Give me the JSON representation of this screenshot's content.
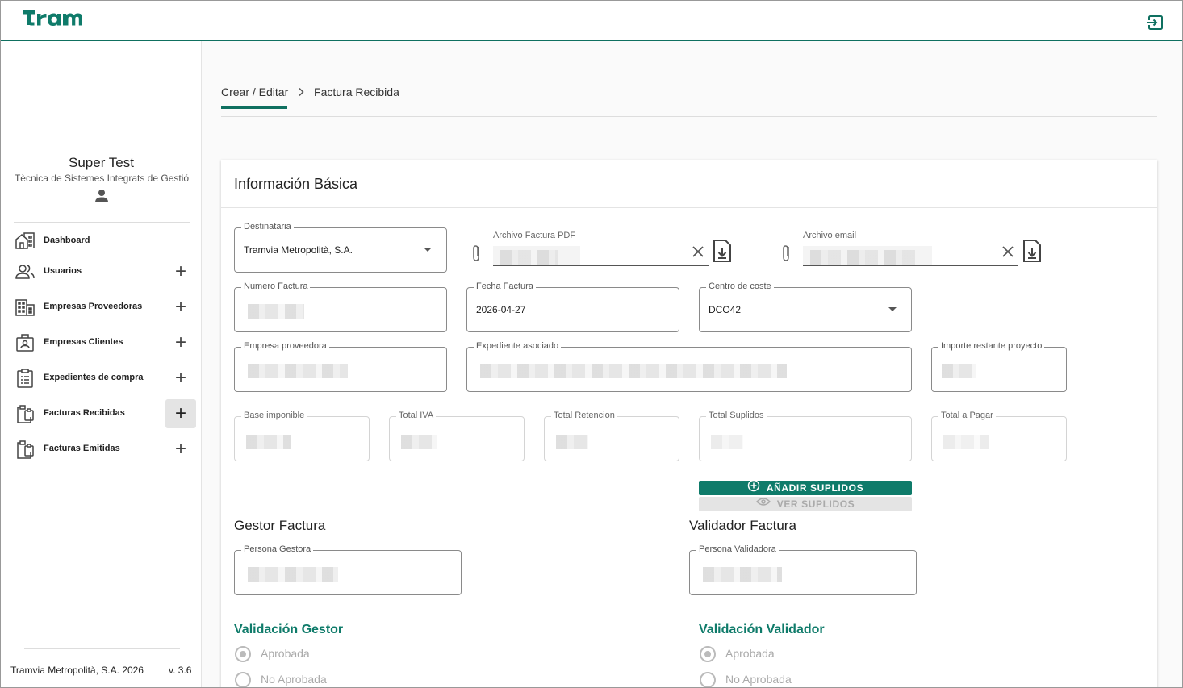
{
  "header": {
    "logo": "TRAM",
    "logout_icon": "logout-icon"
  },
  "user": {
    "name": "Super Test",
    "org": "Tècnica de Sistemes Integrats de Gestió",
    "icon": "person-icon"
  },
  "sidebar": {
    "items": [
      {
        "label": "Dashboard",
        "icon": "dashboard-icon"
      },
      {
        "label": "Usuarios",
        "icon": "users-icon"
      },
      {
        "label": "Empresas Proveedoras",
        "icon": "building-icon"
      },
      {
        "label": "Empresas Clientes",
        "icon": "badge-icon"
      },
      {
        "label": "Expedientes de compra",
        "icon": "clipboard-list-icon"
      },
      {
        "label": "Facturas Recibidas",
        "icon": "clipboard-icon"
      },
      {
        "label": "Facturas Emitidas",
        "icon": "clipboard-icon"
      }
    ],
    "plus": "+",
    "footer_company": "Tramvia Metropolità, S.A. 2026",
    "footer_version": "v. 3.6"
  },
  "breadcrumb": {
    "first": "Crear / Editar",
    "separator": "chevron-right-icon",
    "second": "Factura Recibida"
  },
  "card": {
    "title": "Información Básica"
  },
  "form": {
    "destinataria": {
      "label": "Destinataria",
      "value": "Tramvia Metropolità, S.A."
    },
    "archivo_pdf": {
      "label": "Archivo Factura PDF"
    },
    "archivo_email": {
      "label": "Archivo email"
    },
    "numero_factura": {
      "label": "Numero Factura"
    },
    "fecha_factura": {
      "label": "Fecha Factura",
      "value": "2026-04-27"
    },
    "centro_coste": {
      "label": "Centro de coste",
      "value": "DCO42"
    },
    "empresa_proveedora": {
      "label": "Empresa proveedora"
    },
    "expediente_asociado": {
      "label": "Expediente asociado"
    },
    "importe_restante": {
      "label": "Importe restante proyecto"
    },
    "base_imponible": {
      "label": "Base imponible"
    },
    "total_iva": {
      "label": "Total IVA"
    },
    "total_retencion": {
      "label": "Total Retencion"
    },
    "total_suplidos": {
      "label": "Total Suplidos"
    },
    "total_pagar": {
      "label": "Total a Pagar"
    }
  },
  "buttons": {
    "add_suplidos": "AÑADIR SUPLIDOS",
    "view_suplidos": "VER SUPLIDOS"
  },
  "gestor": {
    "title": "Gestor Factura",
    "field_label": "Persona Gestora"
  },
  "validador": {
    "title": "Validador Factura",
    "field_label": "Persona Validadora"
  },
  "validacion_gestor": {
    "title": "Validación Gestor",
    "approved": "Aprobada",
    "not_approved": "No Aprobada"
  },
  "validacion_validador": {
    "title": "Validación Validador",
    "approved": "Aprobada",
    "not_approved": "No Aprobada"
  },
  "colors": {
    "brand": "#0f7b6a"
  }
}
